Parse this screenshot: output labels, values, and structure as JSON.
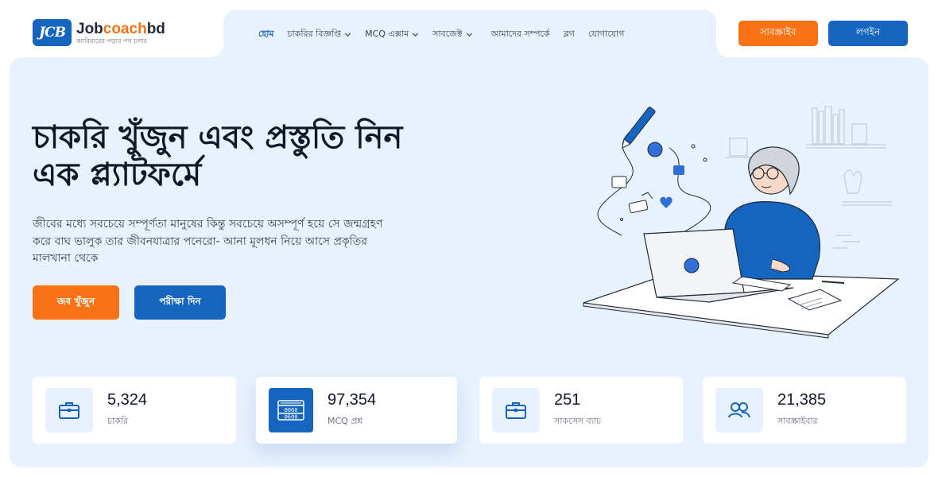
{
  "brand": {
    "logo_mark": "JCB",
    "name_part1": "Job",
    "name_part2": "coach",
    "name_part3": "bd",
    "tagline": "ক্যারিয়ারের পড়ার পথ চলার"
  },
  "nav": {
    "items": [
      {
        "label": "হোম",
        "active": true,
        "dropdown": false
      },
      {
        "label": "চাকরির বিজ্ঞপ্তি",
        "active": false,
        "dropdown": true
      },
      {
        "label": "MCQ এক্সাম",
        "active": false,
        "dropdown": true
      },
      {
        "label": "সাবজেক্ট",
        "active": false,
        "dropdown": true
      },
      {
        "label": "আমাদের সম্পর্কে",
        "active": false,
        "dropdown": false
      },
      {
        "label": "ব্লগ",
        "active": false,
        "dropdown": false
      },
      {
        "label": "যোগাযোগ",
        "active": false,
        "dropdown": false
      }
    ],
    "subscribe_label": "সাবস্ক্রাইব",
    "login_label": "লগইন"
  },
  "hero": {
    "title_line1": "চাকরি খুঁজুন এবং প্রস্তুতি নিন",
    "title_line2": "এক প্ল্যাটফর্মে",
    "description": "জীবের মধ্যে সবচেয়ে সম্পূর্ণতা মানুষের কিন্তু সবচেয়ে অসম্পূর্ণ হয়ে সে জন্মগ্রহণ করে বাঘ ভালুক তার জীবনযাত্রার পনেরো- আনা মূলধন নিয়ে আসে প্রকৃতির মালখানা থেকে",
    "find_job_label": "জব খুঁজুন",
    "exam_label": "পরীক্ষা দিন"
  },
  "stats": [
    {
      "value": "5,324",
      "label": "চাকরি",
      "icon": "briefcase-icon"
    },
    {
      "value": "97,354",
      "label": "MCQ প্রশ্ন",
      "icon": "question-grid-icon"
    },
    {
      "value": "251",
      "label": "সাকসেস ব্যাচ",
      "icon": "briefcase-icon"
    },
    {
      "value": "21,385",
      "label": "সাবস্ক্রাইবার",
      "icon": "users-icon"
    }
  ],
  "colors": {
    "primary": "#1565c0",
    "accent": "#f97316",
    "hero_bg": "#e8f1fd"
  }
}
